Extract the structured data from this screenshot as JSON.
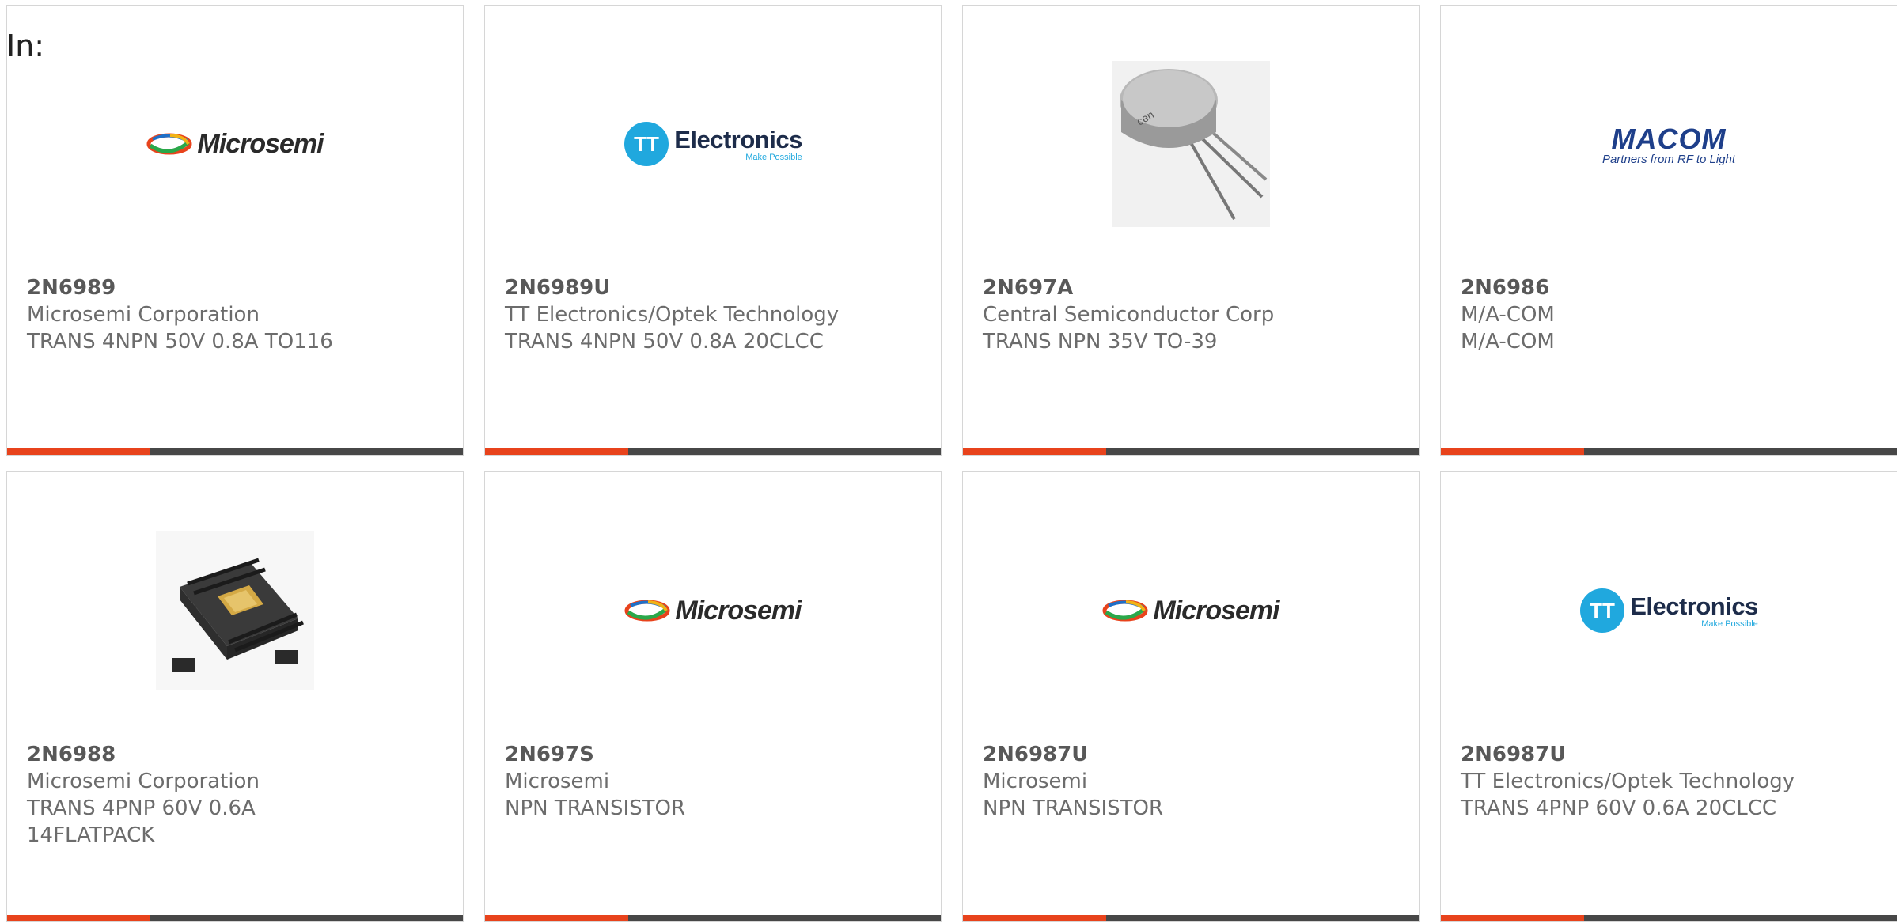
{
  "filter_label": "In:",
  "accent_color": "#e8431c",
  "products": [
    {
      "part_number": "2N6989",
      "manufacturer": "Microsemi Corporation",
      "description": "TRANS 4NPN 50V 0.8A TO116",
      "image": "microsemi-logo"
    },
    {
      "part_number": "2N6989U",
      "manufacturer": "TT Electronics/Optek Technology",
      "description": "TRANS 4NPN 50V 0.8A 20CLCC",
      "image": "tt-electronics-logo"
    },
    {
      "part_number": "2N697A",
      "manufacturer": "Central Semiconductor Corp",
      "description": "TRANS NPN 35V TO-39",
      "image": "to39-transistor-photo"
    },
    {
      "part_number": "2N6986",
      "manufacturer": "M/A-COM",
      "description": "M/A-COM",
      "image": "macom-logo"
    },
    {
      "part_number": "2N6988",
      "manufacturer": "Microsemi Corporation",
      "description": "TRANS 4PNP 60V 0.6A",
      "description_line2": "14FLATPACK",
      "image": "flatpack-chip-photo"
    },
    {
      "part_number": "2N697S",
      "manufacturer": "Microsemi",
      "description": "NPN TRANSISTOR",
      "image": "microsemi-logo"
    },
    {
      "part_number": "2N6987U",
      "manufacturer": "Microsemi",
      "description": "NPN TRANSISTOR",
      "image": "microsemi-logo"
    },
    {
      "part_number": "2N6987U",
      "manufacturer": "TT Electronics/Optek Technology",
      "description": "TRANS 4PNP 60V 0.6A 20CLCC",
      "image": "tt-electronics-logo"
    }
  ],
  "logos": {
    "microsemi": "Microsemi",
    "tt_word": "Electronics",
    "tt_letters": "TT",
    "tt_tag": "Make Possible",
    "macom_word": "MACOM",
    "macom_tag": "Partners from RF to Light"
  }
}
